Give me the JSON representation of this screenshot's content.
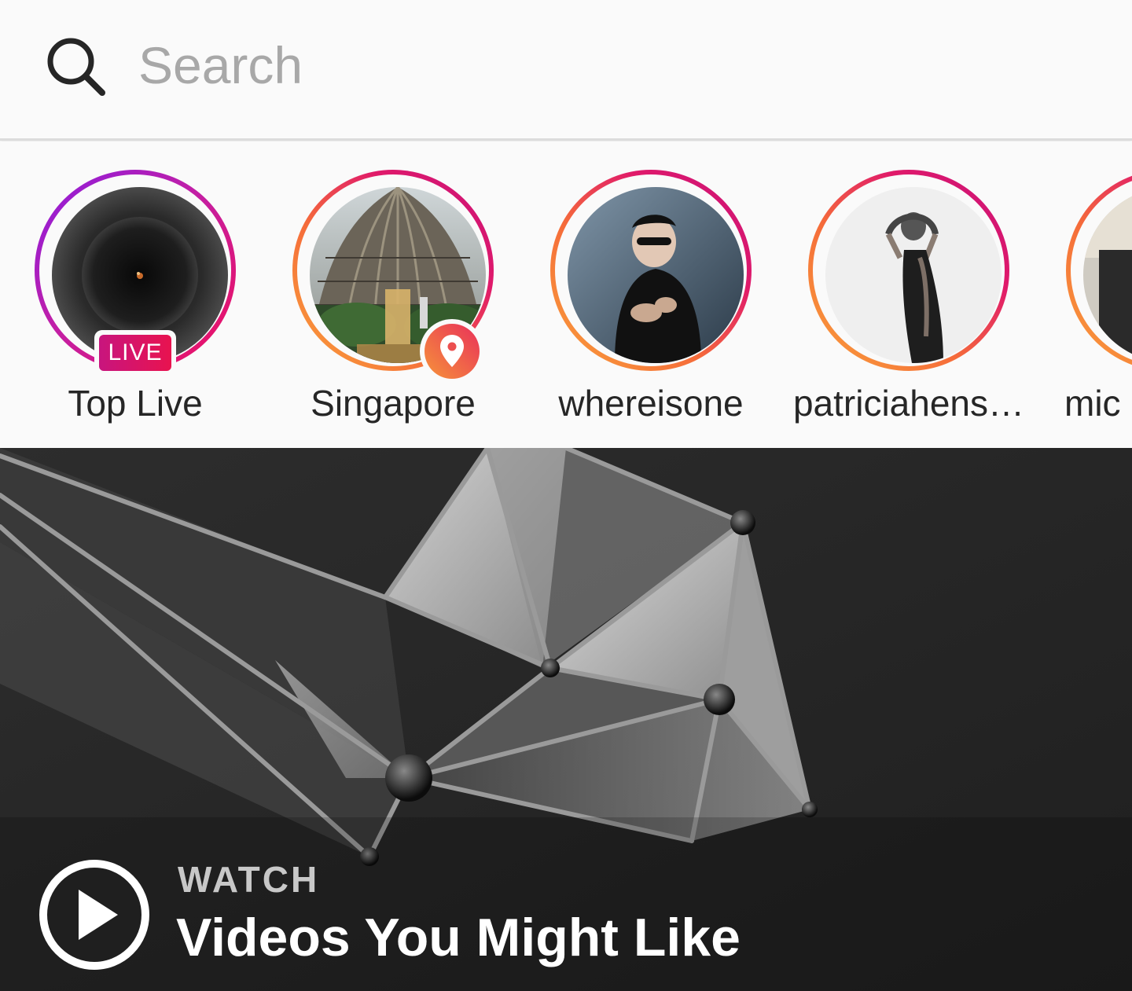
{
  "search": {
    "placeholder": "Search",
    "value": ""
  },
  "stories": [
    {
      "label": "Top Live",
      "badge": "LIVE",
      "ring": "live"
    },
    {
      "label": "Singapore",
      "badge": "location-pin-icon",
      "ring": "standard"
    },
    {
      "label": "whereisone",
      "ring": "standard"
    },
    {
      "label": "patriciahens…",
      "ring": "standard"
    },
    {
      "label": "mic",
      "ring": "standard"
    }
  ],
  "video": {
    "kicker": "WATCH",
    "title": "Videos You Might Like",
    "icon": "play-circle-icon"
  },
  "colors": {
    "live_gradient": [
      "#8a1de0",
      "#f0105a"
    ],
    "story_gradient": [
      "#f9a23b",
      "#c7117a"
    ],
    "placeholder": "#a8a8a8",
    "text": "#262626"
  }
}
